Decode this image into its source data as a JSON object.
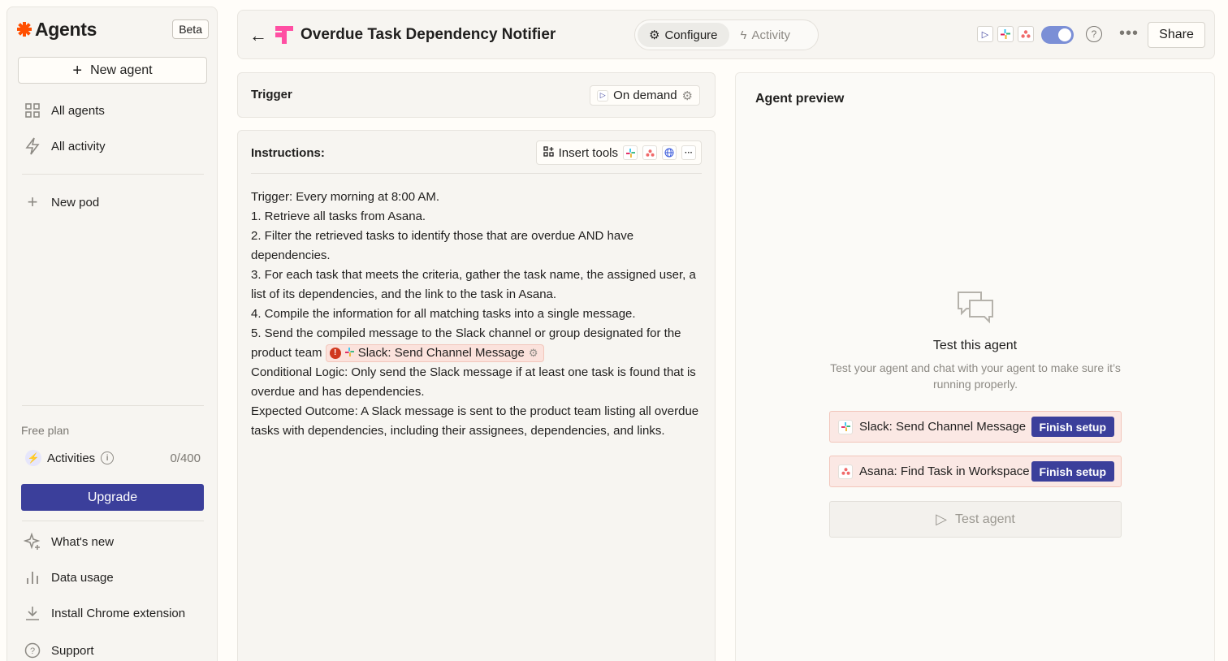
{
  "sidebar": {
    "brand": "Agents",
    "beta_label": "Beta",
    "new_agent_label": "New agent",
    "nav": {
      "all_agents": "All agents",
      "all_activity": "All activity",
      "new_pod": "New pod"
    },
    "plan_label": "Free plan",
    "activities_label": "Activities",
    "activities_quota": "0/400",
    "upgrade_label": "Upgrade",
    "footer": {
      "whats_new": "What's new",
      "data_usage": "Data usage",
      "chrome_extension": "Install Chrome extension",
      "support": "Support"
    }
  },
  "header": {
    "title": "Overdue Task Dependency Notifier",
    "tabs": {
      "configure": "Configure",
      "activity": "Activity"
    },
    "share_label": "Share",
    "toggle_on": true
  },
  "trigger": {
    "label": "Trigger",
    "value": "On demand"
  },
  "instructions": {
    "label": "Instructions:",
    "insert_tools_label": "Insert tools",
    "lines": [
      "Trigger: Every morning at 8:00 AM.",
      "1. Retrieve all tasks from Asana.",
      "2. Filter the retrieved tasks to identify those that are overdue AND have dependencies.",
      "3. For each task that meets the criteria, gather the task name, the assigned user, a list of its dependencies, and the link to the task in Asana.",
      "4. Compile the information for all matching tasks into a single message.",
      "5. Send the compiled message to the Slack channel or group designated for the product team",
      "Conditional Logic: Only send the Slack message if at least one task is found that is overdue and has dependencies.",
      "Expected Outcome: A Slack message is sent to the product team listing all overdue tasks with dependencies, including their assignees, dependencies, and links."
    ],
    "tool_chip_label": "Slack: Send Channel Message"
  },
  "preview": {
    "title": "Agent preview",
    "test_title": "Test this agent",
    "test_subtitle": "Test your agent and chat with your agent to make sure it’s running properly.",
    "setup_items": [
      {
        "label": "Slack: Send Channel Message",
        "button": "Finish setup",
        "app": "slack"
      },
      {
        "label": "Asana: Find Task in Workspace",
        "button": "Finish setup",
        "app": "asana"
      }
    ],
    "test_button_label": "Test agent"
  },
  "colors": {
    "brand_orange": "#ff4f00",
    "primary": "#3b3f9b",
    "error": "#d0381e",
    "chip_bg": "#fbe2dc"
  }
}
